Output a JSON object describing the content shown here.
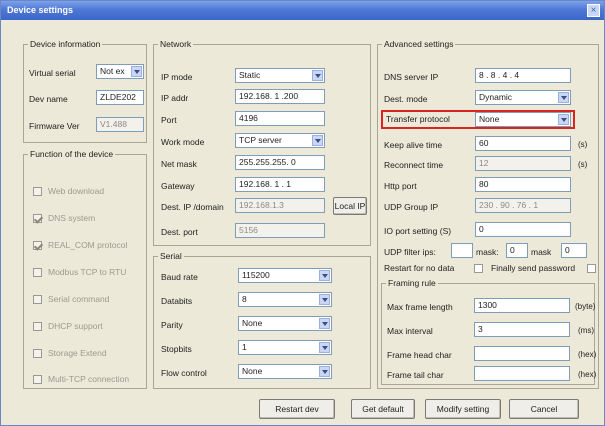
{
  "window": {
    "title": "Device settings",
    "close_glyph": "×"
  },
  "device_info": {
    "legend": "Device information",
    "virtual_serial": {
      "label": "Virtual serial",
      "value": "Not ex"
    },
    "dev_name": {
      "label": "Dev name",
      "value": "ZLDE202"
    },
    "firmware": {
      "label": "Firmware Ver",
      "value": "V1.488"
    }
  },
  "function": {
    "legend": "Function of the device",
    "items": [
      {
        "label": "Web download",
        "checked": false
      },
      {
        "label": "DNS system",
        "checked": true
      },
      {
        "label": "REAL_COM protocol",
        "checked": true
      },
      {
        "label": "Modbus TCP to RTU",
        "checked": false
      },
      {
        "label": "Serial command",
        "checked": false
      },
      {
        "label": "DHCP support",
        "checked": false
      },
      {
        "label": "Storage Extend",
        "checked": false
      },
      {
        "label": "Multi-TCP connection",
        "checked": false
      }
    ]
  },
  "network": {
    "legend": "Network",
    "ip_mode": {
      "label": "IP mode",
      "value": "Static"
    },
    "ip_addr": {
      "label": "IP addr",
      "value": "192.168. 1 .200"
    },
    "port": {
      "label": "Port",
      "value": "4196"
    },
    "work_mode": {
      "label": "Work mode",
      "value": "TCP server"
    },
    "net_mask": {
      "label": "Net mask",
      "value": "255.255.255. 0"
    },
    "gateway": {
      "label": "Gateway",
      "value": "192.168. 1 . 1"
    },
    "dest_ip": {
      "label": "Dest. IP /domain",
      "value": "192.168.1.3",
      "button": "Local IP"
    },
    "dest_port": {
      "label": "Dest. port",
      "value": "5156"
    }
  },
  "serial": {
    "legend": "Serial",
    "baud": {
      "label": "Baud rate",
      "value": "115200"
    },
    "databits": {
      "label": "Databits",
      "value": "8"
    },
    "parity": {
      "label": "Parity",
      "value": "None"
    },
    "stopbits": {
      "label": "Stopbits",
      "value": "1"
    },
    "flow": {
      "label": "Flow control",
      "value": "None"
    }
  },
  "advanced": {
    "legend": "Advanced settings",
    "dns_server": {
      "label": "DNS server IP",
      "value": "8 . 8 . 4 . 4"
    },
    "dest_mode": {
      "label": "Dest. mode",
      "value": "Dynamic"
    },
    "transfer_protocol": {
      "label": "Transfer protocol",
      "value": "None"
    },
    "keep_alive": {
      "label": "Keep alive time",
      "value": "60",
      "unit": "(s)"
    },
    "reconnect": {
      "label": "Reconnect time",
      "value": "12",
      "unit": "(s)"
    },
    "http_port": {
      "label": "Http port",
      "value": "80"
    },
    "udp_group": {
      "label": "UDP Group IP",
      "value": "230 . 90 . 76 . 1"
    },
    "io_port": {
      "label": "IO port setting (S)",
      "value": "0"
    },
    "udp_filter": {
      "label": "UDP filter ips:",
      "ip": "",
      "ip_label": "mask:",
      "mask": "0",
      "mask_label": "mask",
      "mask2": "0"
    },
    "restart_no_data": {
      "label": "Restart for no data",
      "checked": false
    },
    "send_password": {
      "label": "Finally send password",
      "checked": false
    },
    "framing": {
      "legend": "Framing rule",
      "max_length": {
        "label": "Max frame length",
        "value": "1300",
        "unit": "(byte)"
      },
      "max_interval": {
        "label": "Max interval",
        "value": "3",
        "unit": "(ms)"
      },
      "frame_head": {
        "label": "Frame head char",
        "value": "",
        "unit": "(hex)"
      },
      "frame_tail": {
        "label": "Frame tail char",
        "value": "",
        "unit": "(hex)"
      }
    }
  },
  "buttons": {
    "restart": "Restart dev",
    "get_default": "Get default",
    "modify": "Modify setting",
    "cancel": "Cancel"
  }
}
